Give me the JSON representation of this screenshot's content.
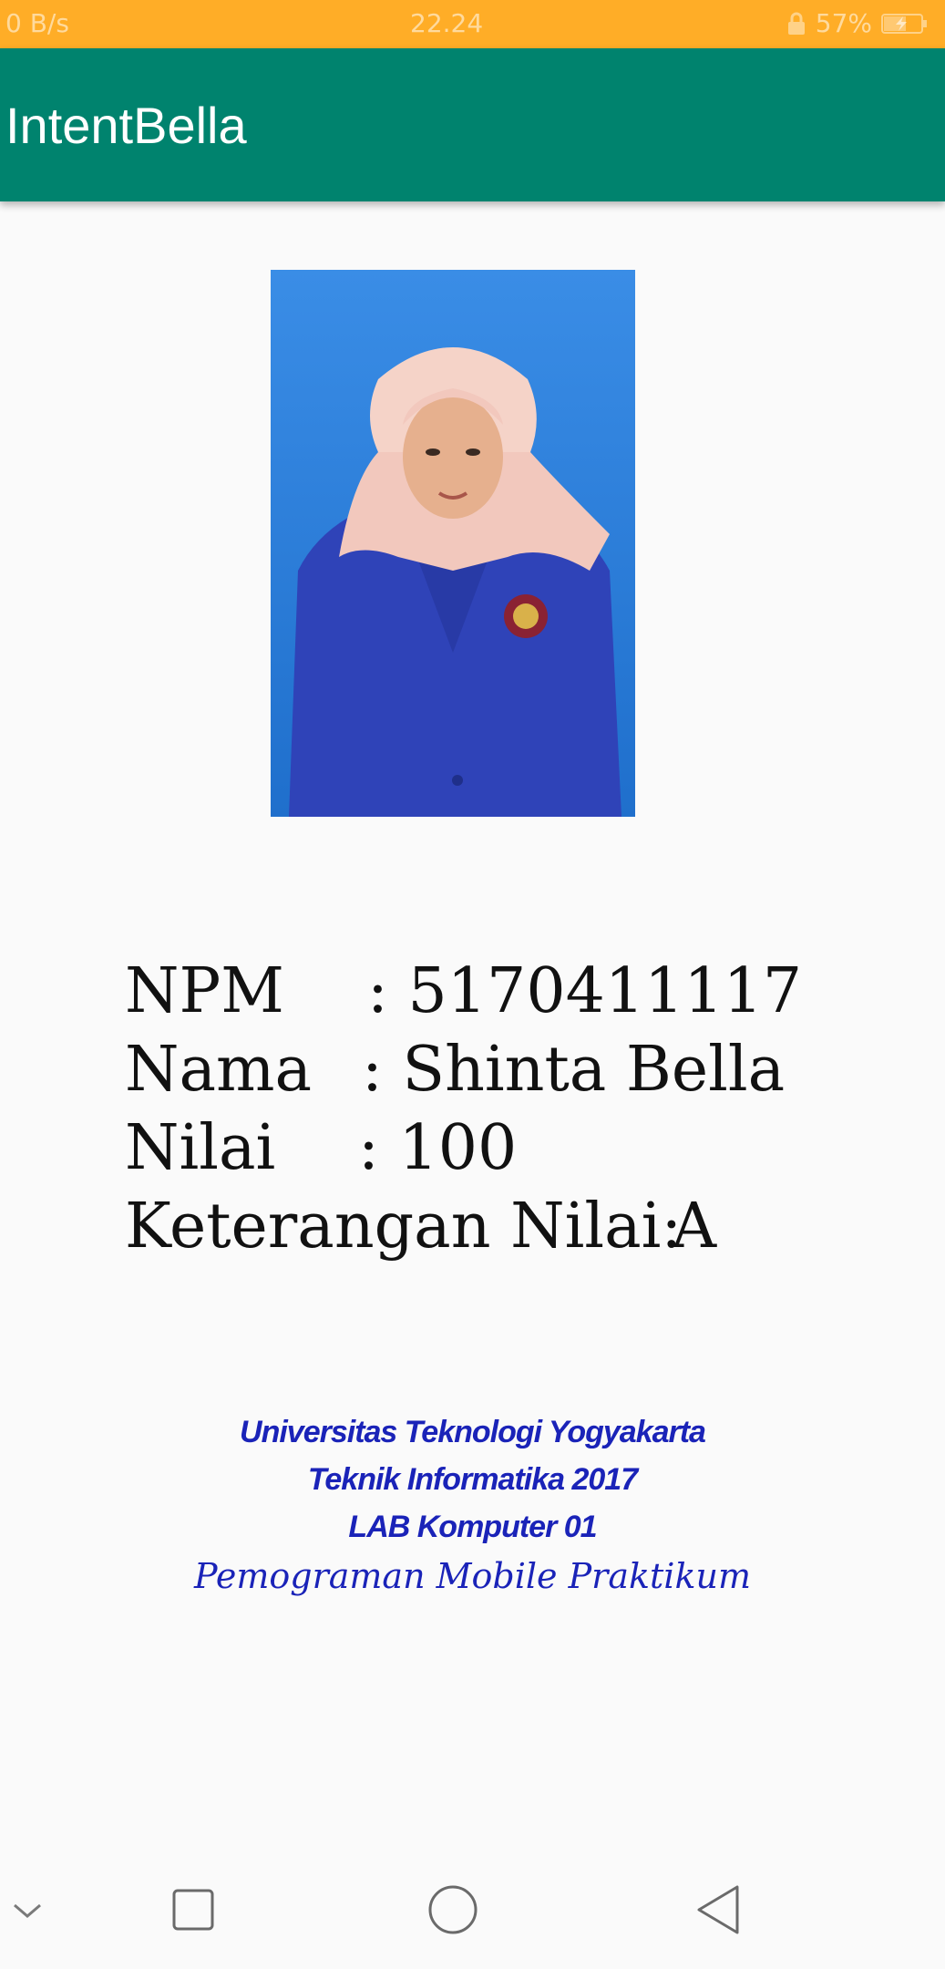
{
  "status_bar": {
    "network_speed": "0 B/s",
    "time": "22.24",
    "battery": "57%"
  },
  "app_bar": {
    "title": "IntentBella"
  },
  "profile": {
    "photo_alt": "",
    "rows": [
      {
        "label": "NPM",
        "value": ": 5170411117"
      },
      {
        "label": "Nama",
        "value": ": Shinta Bella"
      },
      {
        "label": "Nilai",
        "value": ": 100"
      },
      {
        "label": "Keterangan Nilai:",
        "value": "A"
      }
    ]
  },
  "footer": {
    "line1": "Universitas Teknologi Yogyakarta",
    "line2": "Teknik Informatika 2017",
    "line3": "LAB Komputer 01",
    "line4": "Pemograman Mobile Praktikum"
  },
  "nav": {
    "icons": [
      "chevron-down-icon",
      "recent-apps-icon",
      "home-icon",
      "back-icon"
    ]
  },
  "colors": {
    "status_bar": "#ffad27",
    "app_bar": "#00836e",
    "footer_text": "#1a23b8",
    "photo_background": "#2b80d8"
  }
}
